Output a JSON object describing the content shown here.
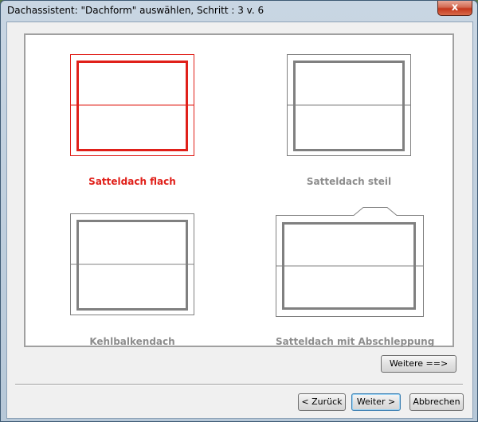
{
  "window": {
    "title": "Dachassistent: \"Dachform\" auswählen, Schritt : 3 v. 6",
    "close_glyph": "x"
  },
  "options": [
    {
      "label": "Satteldach flach",
      "selected": true
    },
    {
      "label": "Satteldach steil",
      "selected": false
    },
    {
      "label": "Kehlbalkendach",
      "selected": false
    },
    {
      "label": "Satteldach mit Abschleppung",
      "selected": false
    }
  ],
  "buttons": {
    "more": "Weitere ==>",
    "back": "< Zurück",
    "next": "Weiter >",
    "cancel": "Abbrechen"
  },
  "colors": {
    "selected": "#e0201a",
    "unselected": "#808080"
  }
}
